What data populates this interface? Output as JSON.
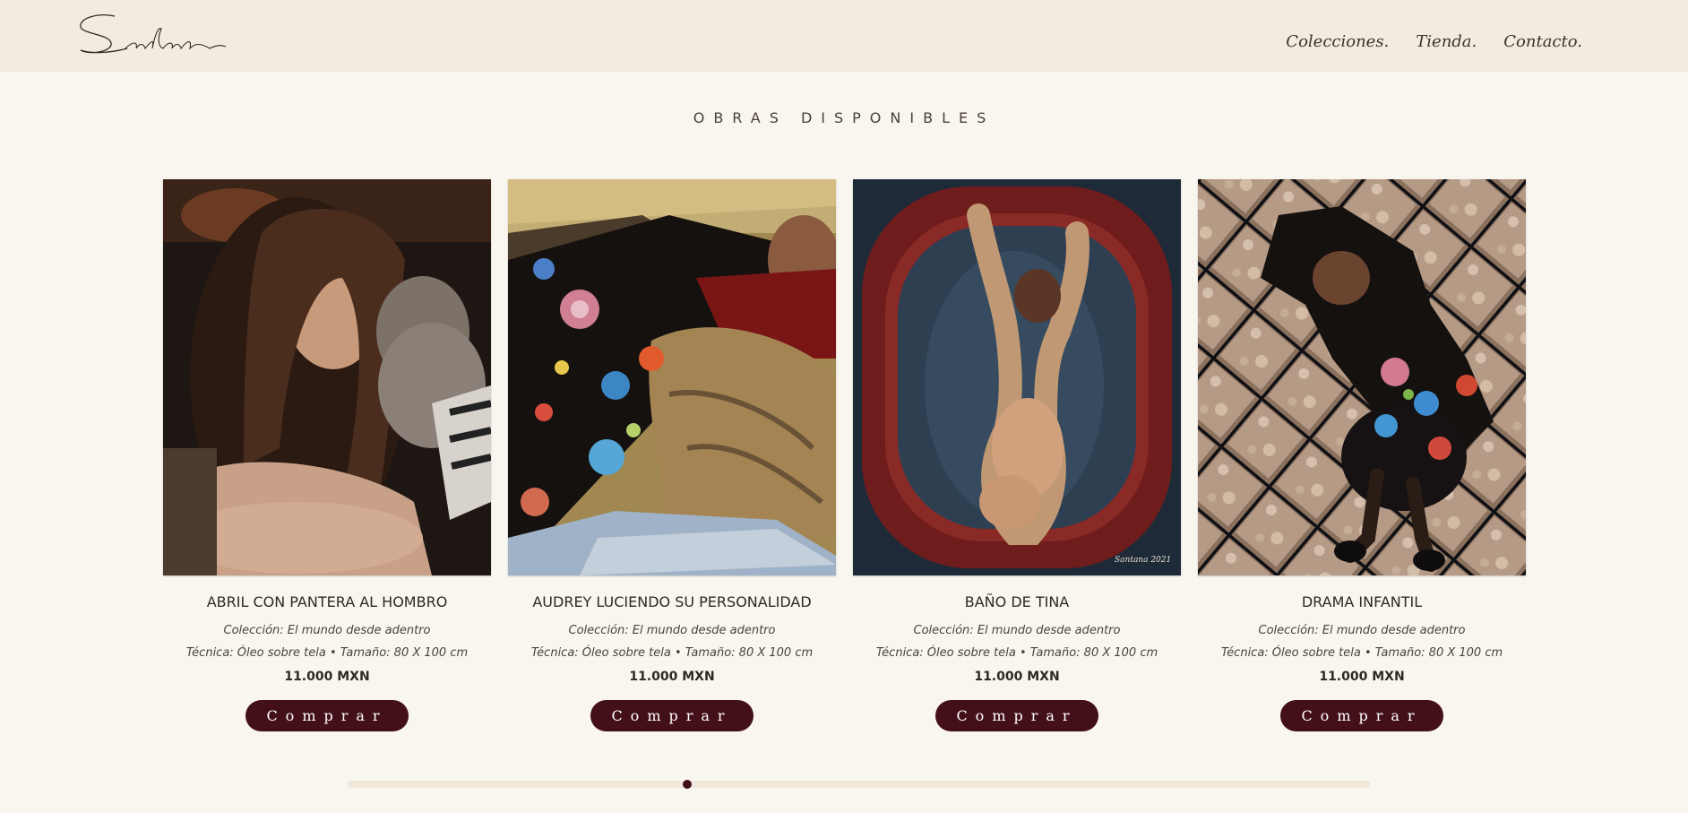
{
  "brand": {
    "logo_text": "Santana"
  },
  "nav": {
    "items": [
      "Colecciones.",
      "Tienda.",
      "Contacto."
    ]
  },
  "section": {
    "title": "OBRAS DISPONIBLES"
  },
  "products": [
    {
      "title": "ABRIL CON PANTERA AL HOMBRO",
      "collection": "Colección: El mundo desde adentro",
      "details": "Técnica: Óleo sobre tela • Tamaño: 80 X 100 cm",
      "price": "11.000 MXN",
      "buy_label": "Comprar",
      "image_icon": "girl-with-cat-painting"
    },
    {
      "title": "AUDREY LUCIENDO SU PERSONALIDAD",
      "collection": "Colección: El mundo desde adentro",
      "details": "Técnica: Óleo sobre tela • Tamaño: 80 X 100 cm",
      "price": "11.000 MXN",
      "buy_label": "Comprar",
      "image_icon": "girl-lying-flowers-painting"
    },
    {
      "title": "BAÑO DE TINA",
      "collection": "Colección: El mundo desde adentro",
      "details": "Técnica: Óleo sobre tela • Tamaño: 80 X 100 cm",
      "price": "11.000 MXN",
      "buy_label": "Comprar",
      "image_icon": "child-in-tub-painting",
      "image_signature": "Santana 2021"
    },
    {
      "title": "DRAMA INFANTIL",
      "collection": "Colección: El mundo desde adentro",
      "details": "Técnica: Óleo sobre tela • Tamaño: 80 X 100 cm",
      "price": "11.000 MXN",
      "buy_label": "Comprar",
      "image_icon": "girl-on-tiles-painting"
    }
  ],
  "carousel": {
    "scroll_position": 0.33
  },
  "colors": {
    "accent": "#430f18",
    "header_bg": "#f2ebe0",
    "page_bg": "#f9f6ef"
  }
}
